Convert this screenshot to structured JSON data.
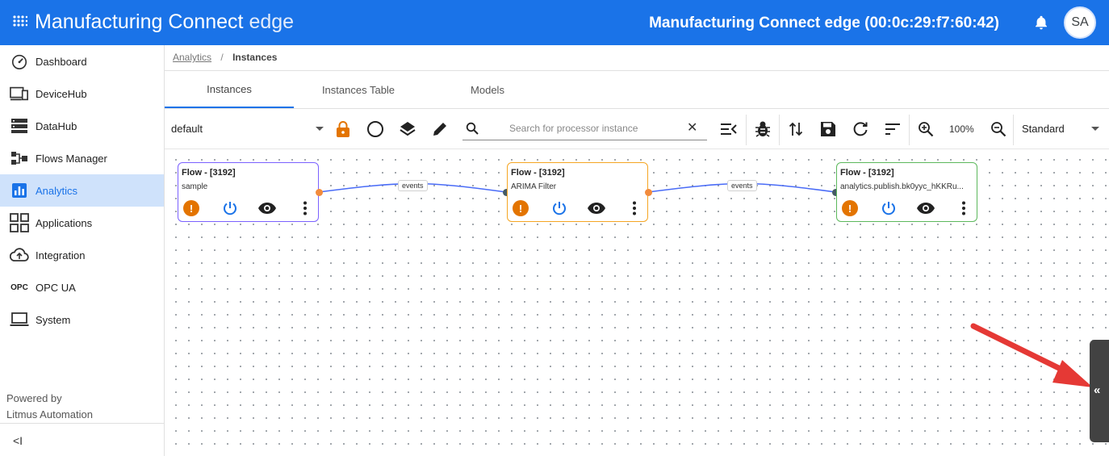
{
  "header": {
    "app_title_main": "Manufacturing Connect",
    "app_title_edge": "edge",
    "device_title": "Manufacturing Connect edge (00:0c:29:f7:60:42)",
    "avatar_initials": "SA",
    "brand_color": "#1a73e8"
  },
  "sidebar": {
    "items": [
      {
        "label": "Dashboard",
        "icon": "speedometer-icon"
      },
      {
        "label": "DeviceHub",
        "icon": "devices-icon"
      },
      {
        "label": "DataHub",
        "icon": "data-stack-icon"
      },
      {
        "label": "Flows Manager",
        "icon": "flow-icon"
      },
      {
        "label": "Analytics",
        "icon": "bar-chart-icon",
        "active": true
      },
      {
        "label": "Applications",
        "icon": "apps-grid-icon"
      },
      {
        "label": "Integration",
        "icon": "cloud-upload-icon"
      },
      {
        "label": "OPC UA",
        "icon": "opc-icon",
        "icon_text": "OPC"
      },
      {
        "label": "System",
        "icon": "laptop-icon"
      }
    ],
    "powered_by_line1": "Powered by",
    "powered_by_line2": "Litmus Automation",
    "collapse_glyph": "<I"
  },
  "breadcrumb": {
    "parent": "Analytics",
    "separator": "/",
    "current": "Instances"
  },
  "tabs": [
    {
      "label": "Instances",
      "active": true
    },
    {
      "label": "Instances Table"
    },
    {
      "label": "Models"
    }
  ],
  "toolbar": {
    "group_select": "default",
    "search_placeholder": "Search for processor instance",
    "clear_glyph": "✕",
    "zoom_level": "100%",
    "mode_select": "Standard"
  },
  "nodes": [
    {
      "title": "Flow - [3192]",
      "subtitle": "sample",
      "border_color": "#7b61ff"
    },
    {
      "title": "Flow - [3192]",
      "subtitle": "ARIMA Filter",
      "border_color": "#f5a623"
    },
    {
      "title": "Flow - [3192]",
      "subtitle": "analytics.publish.bk0yyc_hKKRu...",
      "border_color": "#5cb85c"
    }
  ],
  "edges": [
    {
      "label": "events"
    },
    {
      "label": "events"
    }
  ],
  "side_panel": {
    "toggle_glyph": "«"
  },
  "colors": {
    "warning": "#e37400",
    "power": "#1a73e8",
    "edge": "#4a6cf7",
    "port_out": "#f28b3c",
    "port_in": "#455a64",
    "annotation_arrow": "#e53935"
  }
}
